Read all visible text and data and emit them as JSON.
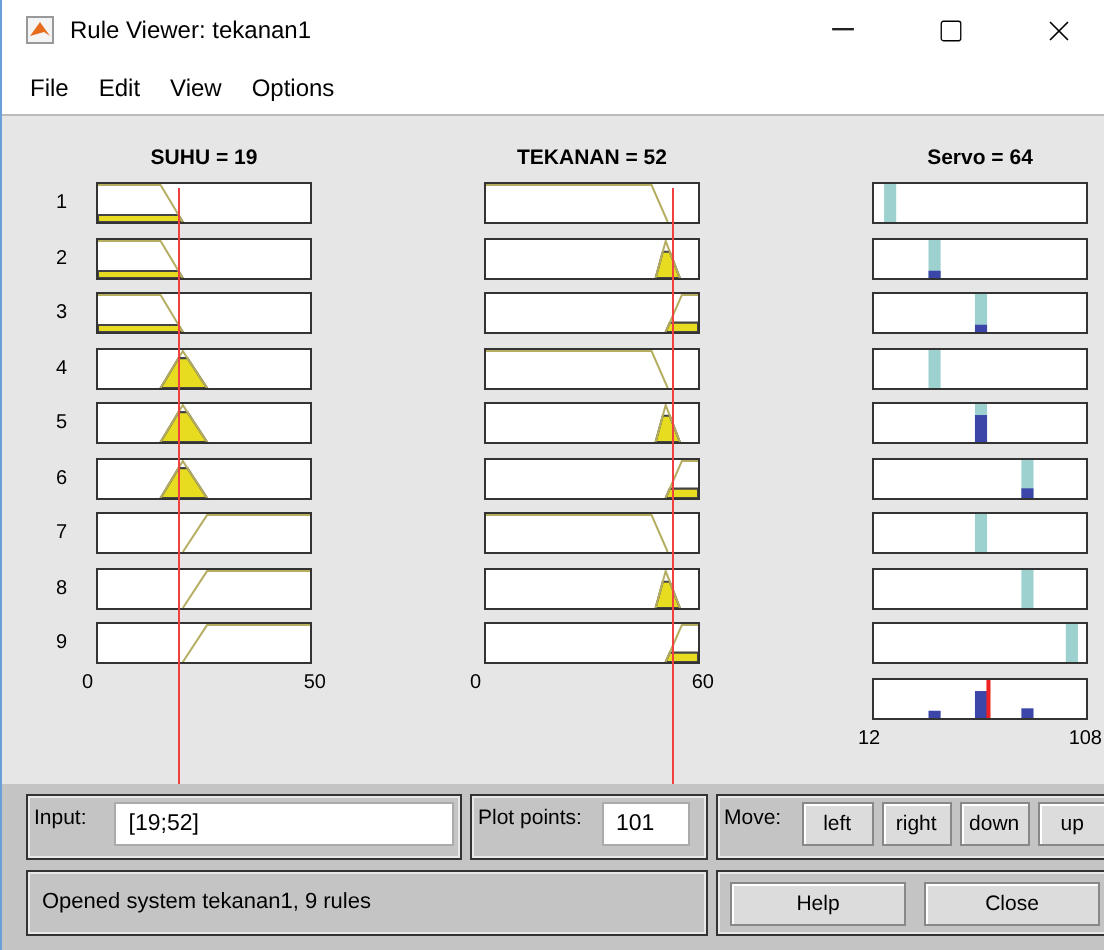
{
  "window": {
    "title": "Rule Viewer: tekanan1"
  },
  "menu": [
    "File",
    "Edit",
    "View",
    "Options"
  ],
  "inputs": [
    {
      "title": "SUHU = 19",
      "axis": [
        "0",
        "50"
      ],
      "line": {
        "level": 0.38
      }
    },
    {
      "title": "TEKANAN = 52",
      "axis": [
        "0",
        "60"
      ],
      "line": {
        "level": 0.867
      }
    }
  ],
  "output": {
    "title": "Servo = 64",
    "axis": [
      "12",
      "108"
    ],
    "line": {
      "level": 0.54
    }
  },
  "rules": [
    {
      "number": "1",
      "inputs": [
        {
          "kind": "low"
        },
        {
          "kind": "low"
        }
      ],
      "output": {
        "kind": "very_low"
      }
    },
    {
      "number": "2",
      "inputs": [
        {
          "kind": "low"
        },
        {
          "kind": "medium"
        }
      ],
      "output": {
        "kind": "low"
      }
    },
    {
      "number": "3",
      "inputs": [
        {
          "kind": "low"
        },
        {
          "kind": "high"
        }
      ],
      "output": {
        "kind": "medium"
      }
    },
    {
      "number": "4",
      "inputs": [
        {
          "kind": "medium"
        },
        {
          "kind": "low"
        }
      ],
      "output": {
        "kind": "low"
      }
    },
    {
      "number": "5",
      "inputs": [
        {
          "kind": "medium"
        },
        {
          "kind": "medium"
        }
      ],
      "output": {
        "kind": "medium"
      }
    },
    {
      "number": "6",
      "inputs": [
        {
          "kind": "medium"
        },
        {
          "kind": "high"
        }
      ],
      "output": {
        "kind": "high"
      }
    },
    {
      "number": "7",
      "inputs": [
        {
          "kind": "high"
        },
        {
          "kind": "low"
        }
      ],
      "output": {
        "kind": "medium"
      }
    },
    {
      "number": "8",
      "inputs": [
        {
          "kind": "high"
        },
        {
          "kind": "medium"
        }
      ],
      "output": {
        "kind": "high"
      }
    },
    {
      "number": "9",
      "inputs": [
        {
          "kind": "high"
        },
        {
          "kind": "high"
        }
      ],
      "output": {
        "kind": "very_high"
      }
    }
  ],
  "input_field": {
    "label": "Input:",
    "value": "[19;52]"
  },
  "plot_points": {
    "label": "Plot points:",
    "value": "101"
  },
  "move": {
    "label": "Move:",
    "buttons": [
      "left",
      "right",
      "down",
      "up"
    ]
  },
  "status": "Opened system tekanan1, 9 rules",
  "buttons": [
    "Help",
    "Close"
  ]
}
